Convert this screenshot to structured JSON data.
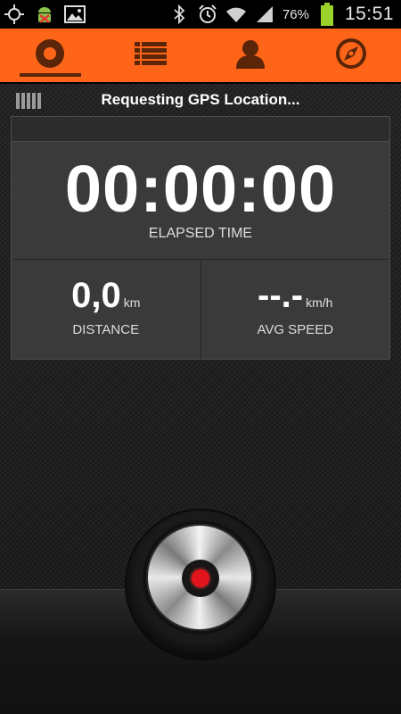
{
  "status_bar": {
    "battery_percent": "76%",
    "time": "15:51",
    "left_icons": [
      "gps-target-icon",
      "android-debug-icon",
      "image-icon"
    ],
    "right_icons": [
      "bluetooth-icon",
      "alarm-clock-icon",
      "wifi-icon",
      "signal-icon",
      "battery-icon"
    ]
  },
  "tabs": [
    {
      "name": "record",
      "icon": "record-circle-icon",
      "active": true
    },
    {
      "name": "history",
      "icon": "list-icon",
      "active": false
    },
    {
      "name": "profile",
      "icon": "person-icon",
      "active": false
    },
    {
      "name": "explore",
      "icon": "compass-icon",
      "active": false
    }
  ],
  "gps": {
    "status_text": "Requesting GPS Location..."
  },
  "timer": {
    "value": "00:00:00",
    "label": "ELAPSED TIME"
  },
  "distance": {
    "value": "0,0",
    "unit": "km",
    "label": "DISTANCE"
  },
  "avg_speed": {
    "value": "--.-",
    "unit": "km/h",
    "label": "AVG SPEED"
  },
  "colors": {
    "accent": "#ff6519",
    "record_red": "#e4141c"
  }
}
